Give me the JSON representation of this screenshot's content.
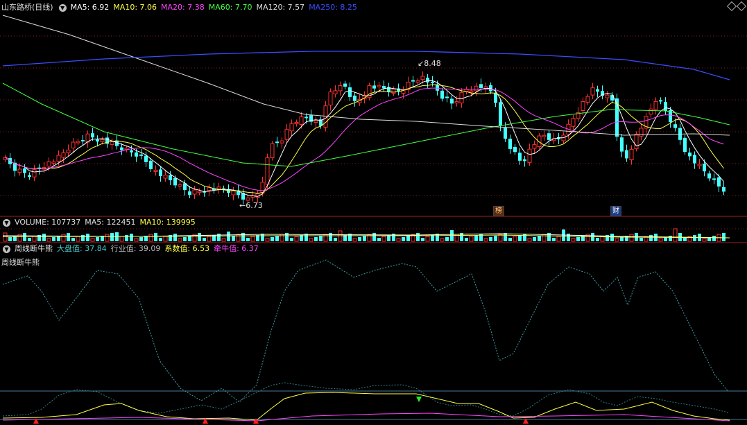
{
  "main": {
    "title": "山东路桥(日线)",
    "ma": [
      {
        "label": "MA5: 6.92",
        "color": "#ffffff"
      },
      {
        "label": "MA10: 7.06",
        "color": "#ffff44"
      },
      {
        "label": "MA20: 7.38",
        "color": "#ff44ff"
      },
      {
        "label": "MA60: 7.70",
        "color": "#44ff44"
      },
      {
        "label": "MA120: 7.57",
        "color": "#dddddd"
      },
      {
        "label": "MA250: 8.25",
        "color": "#3a4cff"
      }
    ],
    "high_label": "8.48",
    "low_label": "6.73",
    "badge_1": "榜",
    "badge_2": "财"
  },
  "volume": {
    "label": "VOLUME: 107737",
    "ma5": "MA5: 122451",
    "ma10": "MA10: 139995"
  },
  "indicator": {
    "name": "周线断牛熊",
    "v1": "大盘值: 37.84",
    "v2": "行业值: 39.09",
    "v3": "系数值: 6.53",
    "v4": "牵牛值: 6.37",
    "subtitle": "周线断牛熊"
  },
  "colors": {
    "up": "#ff3030",
    "down": "#44ffff",
    "grid": "#8b1a1a"
  },
  "icons": {
    "collapse": "chevron-down-icon",
    "top_right": "diamond-icon"
  }
}
